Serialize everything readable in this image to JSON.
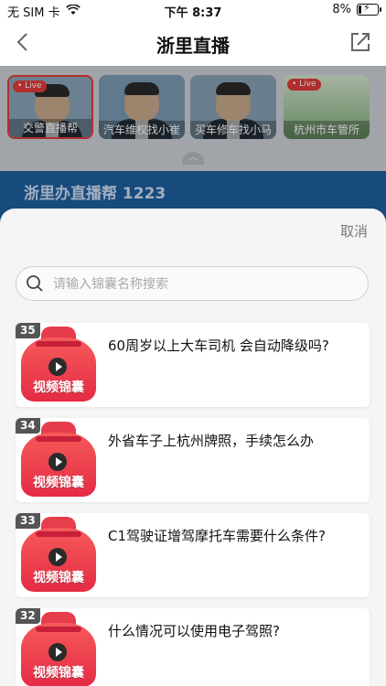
{
  "status_bar": {
    "carrier": "无 SIM 卡",
    "time": "下午 8:37",
    "battery": "8%"
  },
  "nav": {
    "title": "浙里直播"
  },
  "live_tiles": [
    {
      "caption": "交警直播帮",
      "live": "Live",
      "color": "#6b8fa8"
    },
    {
      "caption": "汽车维权找小崔",
      "live": "",
      "color": "#5f86a5"
    },
    {
      "caption": "买车修车找小马",
      "live": "",
      "color": "#6a88a2"
    },
    {
      "caption": "杭州市车管所",
      "live": "Live",
      "color": "#7fa77a"
    }
  ],
  "banner": {
    "title": "浙里办直播帮 1223"
  },
  "sheet": {
    "cancel_label": "取消",
    "search_placeholder": "请输入锦囊名称搜索",
    "items": [
      {
        "num": "35",
        "thumb_label": "视频锦囊",
        "question": "60周岁以上大车司机 会自动降级吗?"
      },
      {
        "num": "34",
        "thumb_label": "视频锦囊",
        "question": "外省车子上杭州牌照，手续怎么办"
      },
      {
        "num": "33",
        "thumb_label": "视频锦囊",
        "question": "C1驾驶证增驾摩托车需要什么条件?"
      },
      {
        "num": "32",
        "thumb_label": "视频锦囊",
        "question": "什么情况可以使用电子驾照?"
      }
    ]
  }
}
